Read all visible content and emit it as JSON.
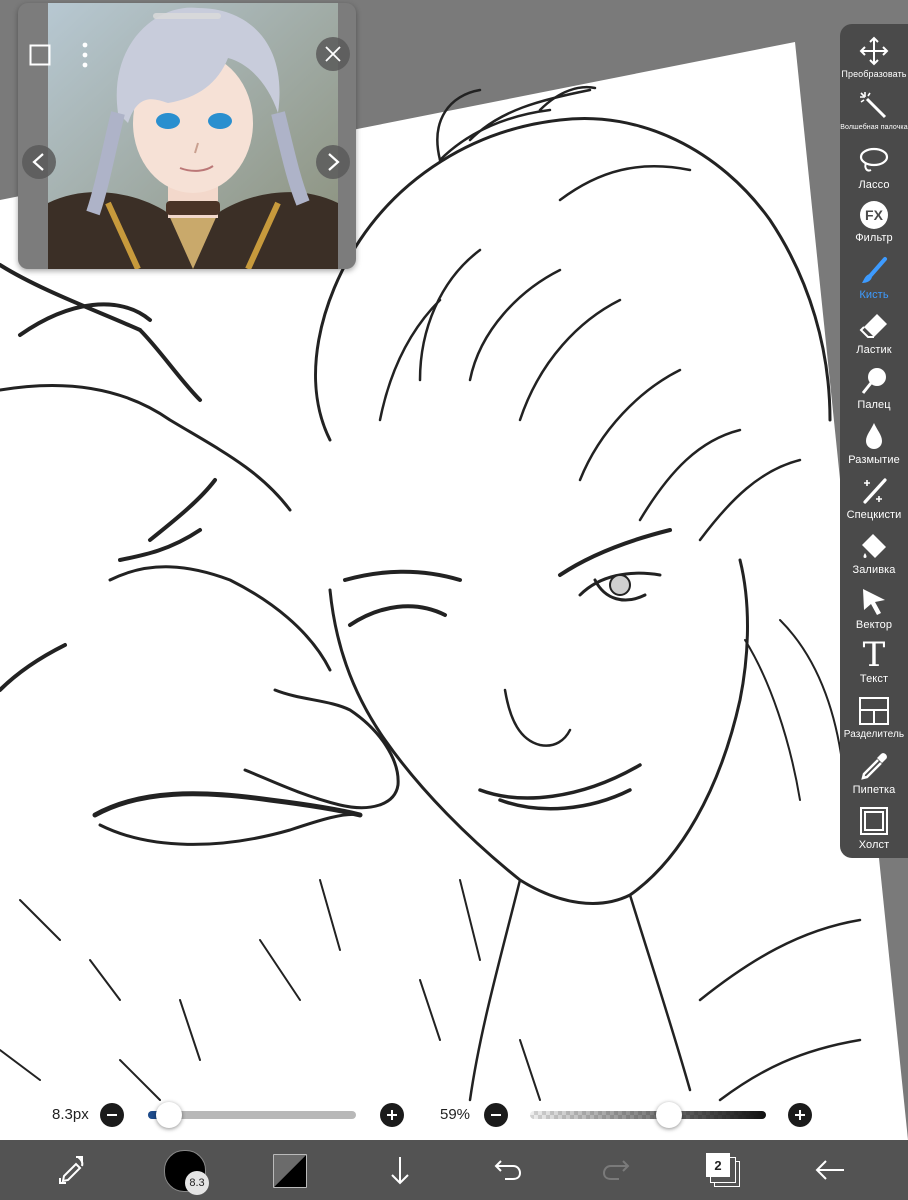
{
  "toolbar": {
    "items": [
      {
        "label": "Преобразовать",
        "icon": "move-arrows-icon"
      },
      {
        "label": "Волшебная палочка",
        "icon": "magic-wand-icon"
      },
      {
        "label": "Лассо",
        "icon": "lasso-icon"
      },
      {
        "label": "Фильтр",
        "icon": "fx-icon",
        "icon_text": "FX"
      },
      {
        "label": "Кисть",
        "icon": "brush-icon",
        "active": true
      },
      {
        "label": "Ластик",
        "icon": "eraser-icon"
      },
      {
        "label": "Палец",
        "icon": "finger-smudge-icon"
      },
      {
        "label": "Размытие",
        "icon": "blur-drop-icon"
      },
      {
        "label": "Спецкисти",
        "icon": "special-brush-icon"
      },
      {
        "label": "Заливка",
        "icon": "fill-bucket-icon"
      },
      {
        "label": "Вектор",
        "icon": "vector-cursor-icon"
      },
      {
        "label": "Текст",
        "icon": "text-icon",
        "icon_text": "T"
      },
      {
        "label": "Разделитель",
        "icon": "frame-divider-icon"
      },
      {
        "label": "Пипетка",
        "icon": "eyedropper-icon"
      },
      {
        "label": "Холст",
        "icon": "canvas-icon"
      }
    ],
    "active_color": "#3d9bff"
  },
  "brush_size": {
    "value_label": "8.3px",
    "fraction": 0.1
  },
  "opacity": {
    "value_label": "59%",
    "fraction": 0.59
  },
  "bottom_bar": {
    "brush_size_badge": "8.3",
    "layer_count": "2",
    "primary_color": "#000000",
    "secondary_color": "transparent"
  },
  "colors": {
    "toolbar_bg": "#4a4a4a",
    "bottom_bar_bg": "#535353",
    "slider_active": "#1e4c8c",
    "workspace_bg": "#7a7a7a"
  }
}
